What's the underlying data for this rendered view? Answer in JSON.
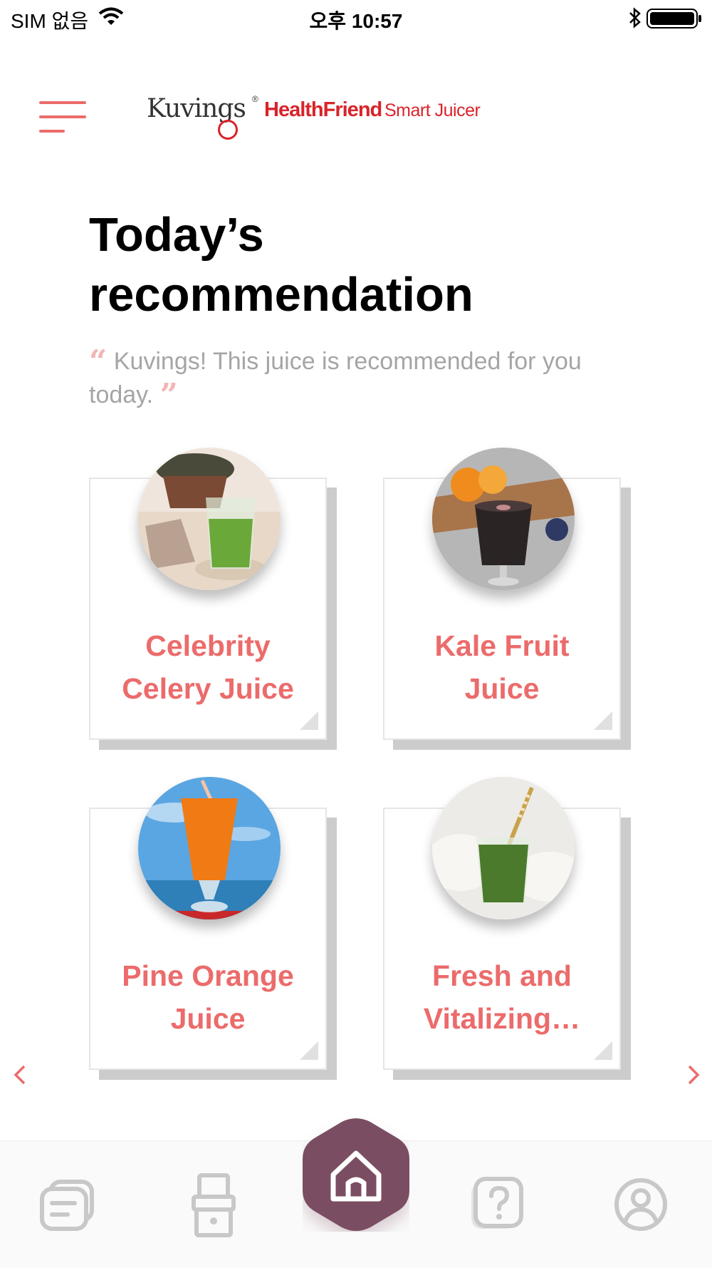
{
  "status_bar": {
    "carrier": "SIM 없음",
    "time": "오후 10:57"
  },
  "header": {
    "logo_brand": "Kuvings",
    "logo_product": "HealthFriend",
    "logo_subtitle": "Smart Juicer"
  },
  "page": {
    "title_line1": "Today’s",
    "title_line2": "recommendation",
    "quote": "Kuvings! This juice is recommended for you today."
  },
  "recipes": [
    {
      "line1": "Celebrity",
      "line2": "Celery Juice"
    },
    {
      "line1": "Kale Fruit",
      "line2": "Juice"
    },
    {
      "line1": "Pine Orange",
      "line2": "Juice"
    },
    {
      "line1": "Fresh and",
      "line2": "Vitalizing…"
    }
  ],
  "tabs": [
    "recipes-icon",
    "juicer-icon",
    "home-icon",
    "help-icon",
    "profile-icon"
  ],
  "colors": {
    "accent": "#ec6b6b",
    "brand_red": "#d9232a",
    "home_button": "#7a4e62",
    "tab_icon": "#c8c8c8"
  }
}
